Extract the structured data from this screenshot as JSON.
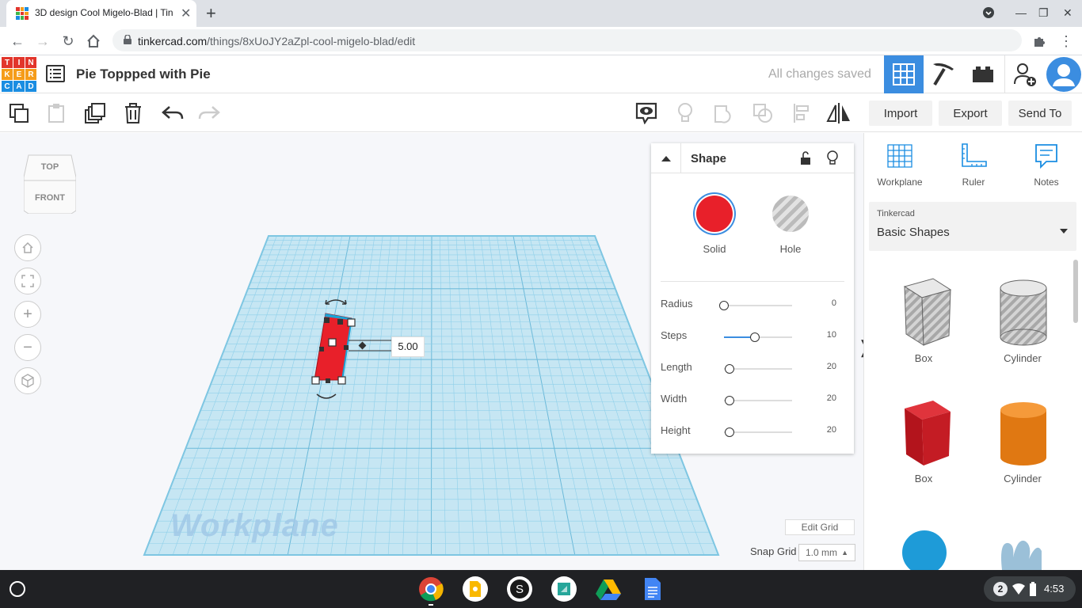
{
  "browser": {
    "tab_title": "3D design Cool Migelo-Blad | Tin",
    "url_domain": "tinkercad.com",
    "url_path": "/things/8xUoJY2aZpl-cool-migelo-blad/edit"
  },
  "header": {
    "logo_letters": [
      "TIN",
      "KER",
      "CAD"
    ],
    "design_title": "Pie Toppped with Pie",
    "save_status": "All changes saved"
  },
  "toolbar": {
    "import_label": "Import",
    "export_label": "Export",
    "send_to_label": "Send To"
  },
  "viewcube": {
    "top": "TOP",
    "front": "FRONT"
  },
  "workspace": {
    "workplane_label": "Workplane",
    "dimension_value": "5.00",
    "edit_grid_label": "Edit Grid",
    "snap_grid_label": "Snap Grid",
    "snap_grid_value": "1.0 mm"
  },
  "shape_panel": {
    "title": "Shape",
    "solid_label": "Solid",
    "hole_label": "Hole",
    "solid_color": "#e8202a",
    "properties": [
      {
        "name": "Radius",
        "value": "0",
        "fraction": 0.0
      },
      {
        "name": "Steps",
        "value": "10",
        "fraction": 0.45
      },
      {
        "name": "Length",
        "value": "20",
        "fraction": 0.08
      },
      {
        "name": "Width",
        "value": "20",
        "fraction": 0.08
      },
      {
        "name": "Height",
        "value": "20",
        "fraction": 0.08
      }
    ]
  },
  "right_panel": {
    "workplane_label": "Workplane",
    "ruler_label": "Ruler",
    "notes_label": "Notes",
    "library_source": "Tinkercad",
    "library_name": "Basic Shapes",
    "shapes": [
      "Box",
      "Cylinder",
      "Box",
      "Cylinder"
    ]
  },
  "shelf": {
    "notification_count": "2",
    "time": "4:53"
  },
  "colors": {
    "accent": "#3b8de0",
    "grid": "#8fd0ea",
    "box_red": "#c41c24",
    "cylinder_orange": "#e07812",
    "sphere_blue": "#1e9bd8"
  }
}
